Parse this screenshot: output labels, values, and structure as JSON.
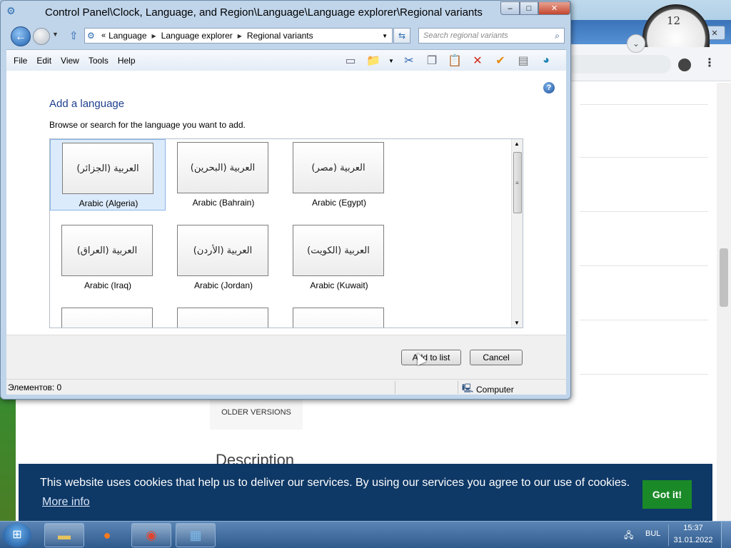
{
  "window": {
    "title": "Control Panel\\Clock, Language, and Region\\Language\\Language explorer\\Regional variants",
    "minimize": "–",
    "maximize": "□",
    "close": "✕"
  },
  "address_bar": {
    "overflow": "«",
    "crumbs": [
      "Language",
      "Language explorer",
      "Regional variants"
    ],
    "search_placeholder": "Search regional variants"
  },
  "menu": [
    "File",
    "Edit",
    "View",
    "Tools",
    "Help"
  ],
  "toolbar_icons": [
    "layout-icon",
    "folder-options-icon",
    "cut-icon",
    "copy-icon",
    "paste-icon",
    "delete-icon",
    "check-icon",
    "properties-icon",
    "web-icon"
  ],
  "content": {
    "heading": "Add a language",
    "instruction": "Browse or search for the language you want to add.",
    "languages": [
      {
        "native": "العربية (الجزائر)",
        "label": "Arabic (Algeria)",
        "selected": true
      },
      {
        "native": "العربية (البحرين)",
        "label": "Arabic (Bahrain)",
        "selected": false
      },
      {
        "native": "العربية (مصر)",
        "label": "Arabic (Egypt)",
        "selected": false
      },
      {
        "native": "العربية (العراق)",
        "label": "Arabic (Iraq)",
        "selected": false
      },
      {
        "native": "العربية (الأردن)",
        "label": "Arabic (Jordan)",
        "selected": false
      },
      {
        "native": "العربية (الكويت)",
        "label": "Arabic (Kuwait)",
        "selected": false
      }
    ],
    "buttons": {
      "add": "Add to list",
      "cancel": "Cancel"
    }
  },
  "status_bar": {
    "items": "Элементов: 0",
    "location": "Computer"
  },
  "browser": {
    "older_versions": "OLDER VERSIONS",
    "description": "Description",
    "clock_number": "12"
  },
  "cookie_banner": {
    "message": "This website uses cookies that help us to deliver our services. By using our services you agree to our use of cookies.",
    "more_info": "More info",
    "button": "Got it!"
  },
  "taskbar": {
    "apps": [
      "explorer",
      "firefox",
      "chrome",
      "control-panel"
    ],
    "language": "BUL",
    "time": "15:37",
    "date": "31.01.2022"
  },
  "colors": {
    "heading": "#1e3f8e",
    "cookie_bg": "#0e3866",
    "cookie_button": "#1a8a28",
    "selection": "#dcebfb"
  }
}
